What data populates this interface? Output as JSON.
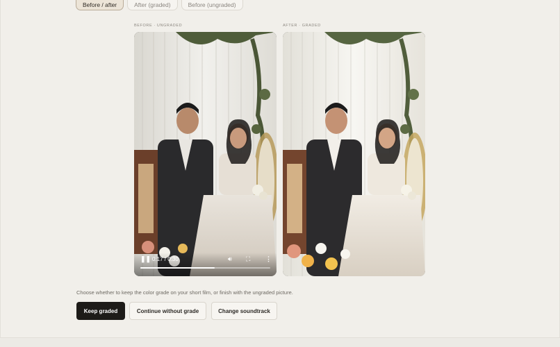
{
  "tabs": [
    {
      "label": "Before / after",
      "active": true
    },
    {
      "label": "After (graded)",
      "active": false
    },
    {
      "label": "Before (ungraded)",
      "active": false
    }
  ],
  "before_panel": {
    "caption": "BEFORE · UNGRADED",
    "player": {
      "time": "0:17 / 0:30",
      "progress": 0.57,
      "icons": [
        "pause-icon",
        "volume-icon",
        "fullscreen-icon",
        "more-options-icon"
      ]
    }
  },
  "after_panel": {
    "caption": "AFTER · GRADED"
  },
  "instruction": "Choose whether to keep the color grade on your short film, or finish with the ungraded picture.",
  "actions": {
    "keep_graded": "Keep graded",
    "continue_without_grade": "Continue without grade",
    "change_soundtrack": "Change soundtrack"
  },
  "colors": {
    "background": "#f1efea",
    "primary_button": "#1d1b18",
    "active_tab": "#ece4d7"
  }
}
